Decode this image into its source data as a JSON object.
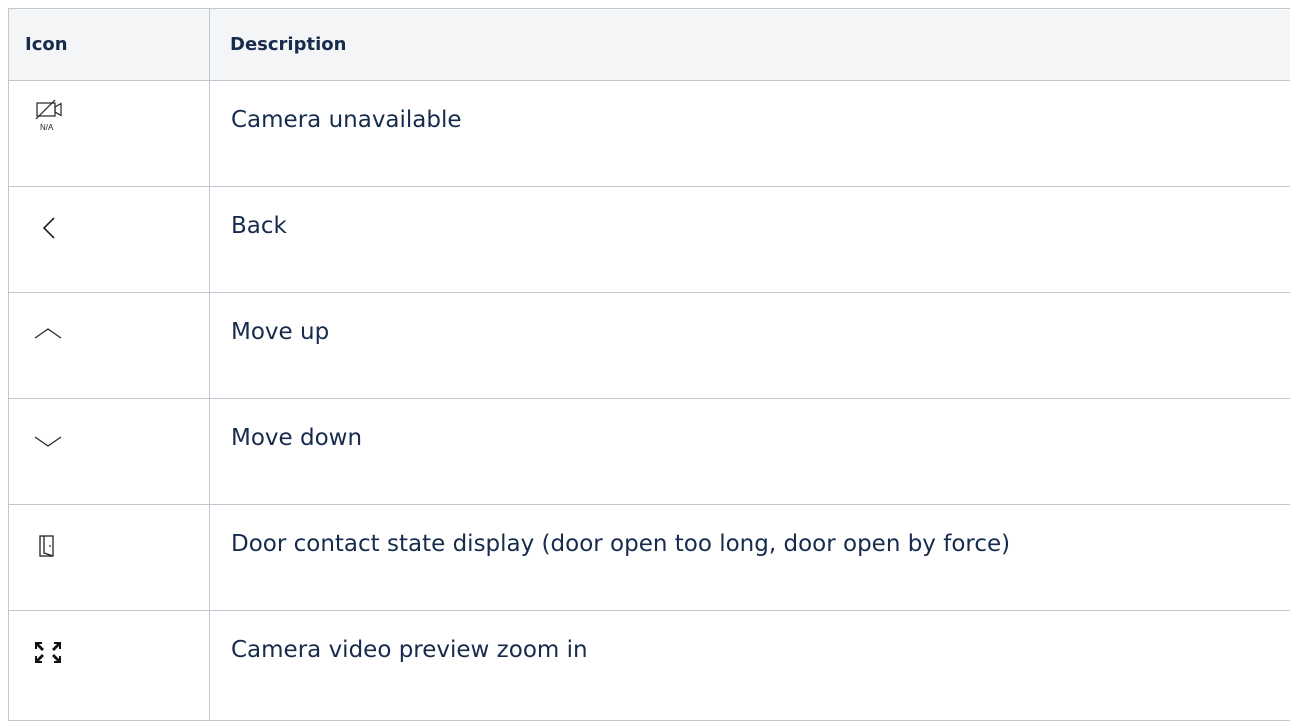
{
  "table": {
    "headers": {
      "icon": "Icon",
      "description": "Description"
    },
    "rows": [
      {
        "icon": "camera-unavailable-icon",
        "icon_caption": "N/A",
        "description": "Camera unavailable"
      },
      {
        "icon": "back-chevron-icon",
        "description": "Back"
      },
      {
        "icon": "chevron-up-icon",
        "description": "Move up"
      },
      {
        "icon": "chevron-down-icon",
        "description": "Move down"
      },
      {
        "icon": "door-contact-icon",
        "description": "Door contact state display (door open too long, door open by force)"
      },
      {
        "icon": "zoom-in-arrows-icon",
        "description": "Camera video preview zoom in"
      }
    ]
  }
}
